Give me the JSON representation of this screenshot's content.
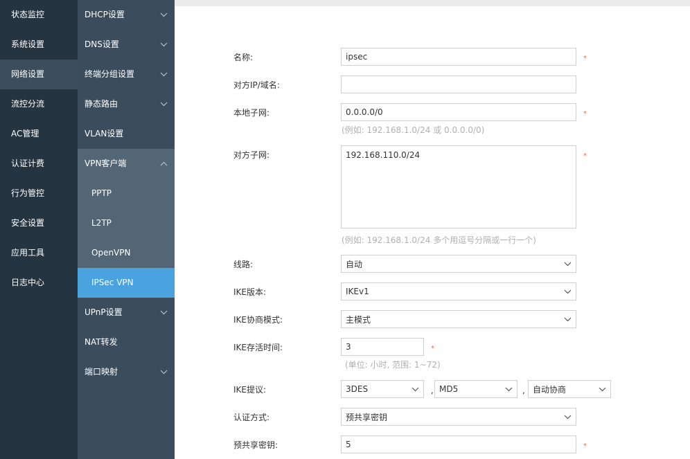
{
  "nav_primary": [
    {
      "label": "状态监控"
    },
    {
      "label": "系统设置"
    },
    {
      "label": "网络设置",
      "active": true
    },
    {
      "label": "流控分流"
    },
    {
      "label": "AC管理"
    },
    {
      "label": "认证计费"
    },
    {
      "label": "行为管控"
    },
    {
      "label": "安全设置"
    },
    {
      "label": "应用工具"
    },
    {
      "label": "日志中心"
    }
  ],
  "nav_secondary": {
    "dhcp": "DHCP设置",
    "dns": "DNS设置",
    "terminal_group": "终端分组设置",
    "static_route": "静态路由",
    "vlan": "VLAN设置",
    "vpn_client": "VPN客户端",
    "vpn_sub": [
      "PPTP",
      "L2TP",
      "OpenVPN",
      "IPSec VPN"
    ],
    "upnp": "UPnP设置",
    "nat": "NAT转发",
    "port_map": "端口映射"
  },
  "form": {
    "name": {
      "label": "名称:",
      "value": "ipsec"
    },
    "peer": {
      "label": "对方IP/域名:",
      "value": ""
    },
    "local_subnet": {
      "label": "本地子网:",
      "value": "0.0.0.0/0",
      "hint": "(例如: 192.168.1.0/24 或 0.0.0.0/0)"
    },
    "peer_subnet": {
      "label": "对方子网:",
      "value": "192.168.110.0/24",
      "hint": "(例如: 192.168.1.0/24 多个用逗号分隔或一行一个)"
    },
    "line": {
      "label": "线路:",
      "value": "自动"
    },
    "ike_version": {
      "label": "IKE版本:",
      "value": "IKEv1"
    },
    "ike_mode": {
      "label": "IKE协商模式:",
      "value": "主模式"
    },
    "ike_lifetime": {
      "label": "IKE存活时间:",
      "value": "3",
      "hint": "(单位: 小时, 范围: 1~72)"
    },
    "ike_proposal": {
      "label": "IKE提议:",
      "enc": "3DES",
      "hash": "MD5",
      "dh": "自动协商",
      "separator": ","
    },
    "auth_method": {
      "label": "认证方式:",
      "value": "预共享密钥"
    },
    "psk": {
      "label": "预共享密钥:",
      "value": "5"
    },
    "required_mark": "*"
  },
  "colors": {
    "nav_primary_bg": "#253441",
    "nav_secondary_bg": "#3b4d5d",
    "nav_sub_bg": "#536676",
    "accent": "#4aa3df",
    "required": "#e86b4a",
    "hint": "#b0b0b0"
  },
  "icons": {
    "chevron_down": "chevron-down-icon",
    "chevron_up": "chevron-up-icon"
  }
}
